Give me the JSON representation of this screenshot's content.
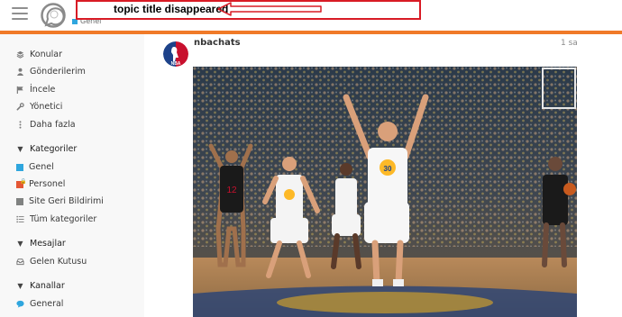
{
  "header": {
    "category": "Genel",
    "category_color": "#2fa6de",
    "accent_color": "#f07a28"
  },
  "annotation": {
    "text": "topic title disappeared",
    "color": "#d81b25"
  },
  "sidebar": {
    "items": [
      {
        "label": "Konular",
        "icon": "layers-icon"
      },
      {
        "label": "Gönderilerim",
        "icon": "user-icon"
      },
      {
        "label": "İncele",
        "icon": "flag-icon"
      },
      {
        "label": "Yönetici",
        "icon": "wrench-icon"
      },
      {
        "label": "Daha fazla",
        "icon": "more-icon"
      }
    ],
    "categories_heading": "Kategoriler",
    "categories": [
      {
        "label": "Genel",
        "color": "#2fa6de"
      },
      {
        "label": "Personel",
        "color": "#e45735"
      },
      {
        "label": "Site Geri Bildirimi",
        "color": "#808281"
      },
      {
        "label": "Tüm kategoriler",
        "icon": "list-icon"
      }
    ],
    "messages_heading": "Mesajlar",
    "messages": [
      {
        "label": "Gelen Kutusu",
        "icon": "inbox-icon"
      }
    ],
    "channels_heading": "Kanallar",
    "channels": [
      {
        "label": "General",
        "icon": "chat-bubble-icon",
        "color": "#2fa6de"
      }
    ]
  },
  "post": {
    "username": "nbachats",
    "time": "1 sa",
    "avatar_text": "NBA"
  }
}
